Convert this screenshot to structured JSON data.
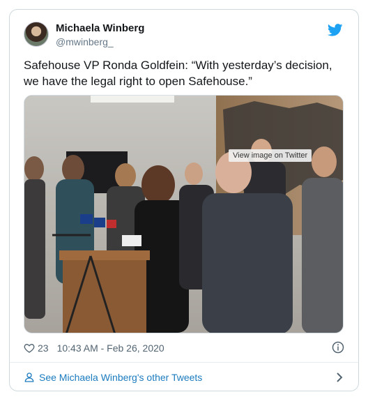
{
  "author": {
    "name": "Michaela Winberg",
    "handle": "@mwinberg_"
  },
  "tweet": {
    "text": "Safehouse VP Ronda Goldfein: “With yesterday’s decision, we have the legal right to open Safehouse.”"
  },
  "media": {
    "badge": "View image on Twitter"
  },
  "meta": {
    "likes": "23",
    "timestamp": "10:43 AM - Feb 26, 2020"
  },
  "footer": {
    "link": "See Michaela Winberg's other Tweets"
  },
  "colors": {
    "link": "#1b7bbf",
    "twitter_blue": "#1da1f2",
    "muted": "#536471"
  },
  "icons": [
    "twitter-bird-icon",
    "heart-icon",
    "info-icon",
    "person-icon",
    "chevron-right-icon"
  ]
}
